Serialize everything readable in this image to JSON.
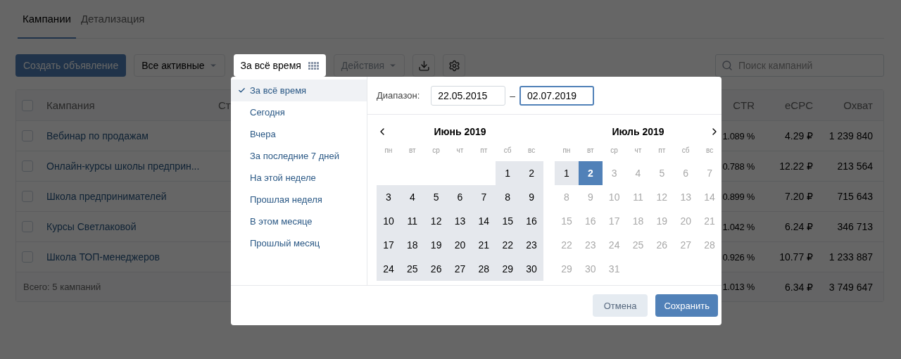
{
  "tabs": [
    {
      "label": "Кампании",
      "selected": true
    },
    {
      "label": "Детализация",
      "selected": false
    }
  ],
  "toolbar": {
    "create_button": "Создать объявление",
    "filter": {
      "label": "Все активные"
    },
    "period": {
      "label": "За всё время",
      "open": true
    },
    "actions": {
      "label": "Действия",
      "disabled": true
    }
  },
  "search": {
    "placeholder": "Поиск кампаний"
  },
  "table": {
    "select_all": {
      "checked": false
    },
    "columns": [
      "Кампания",
      "Ст",
      "CTR",
      "eCPC",
      "Охват"
    ],
    "rows": [
      {
        "checked": false,
        "name": "Вебинар по продажам",
        "ctr": "1.089 %",
        "ecpc": "4.29 ₽",
        "reach": "1 239 840"
      },
      {
        "checked": false,
        "name": "Онлайн-курсы школы предприн...",
        "ctr": "0.788 %",
        "ecpc": "12.22 ₽",
        "reach": "213 564"
      },
      {
        "checked": false,
        "name": "Школа предпринимателей",
        "ctr": "0.899 %",
        "ecpc": "7.20 ₽",
        "reach": "715 643"
      },
      {
        "checked": false,
        "name": "Курсы Светлаковой",
        "ctr": "1.042 %",
        "ecpc": "6.24 ₽",
        "reach": "346 713"
      },
      {
        "checked": false,
        "name": "Школа ТОП-менеджеров",
        "ctr": "0.926 %",
        "ecpc": "10.77 ₽",
        "reach": "1 233 887"
      }
    ],
    "footer": {
      "label": "Всего: 5 кампаний",
      "ctr": "1.013 %",
      "ecpc": "6.34 ₽",
      "reach": "3 749 647"
    }
  },
  "period_popup": {
    "presets": [
      {
        "label": "За всё время",
        "selected": true
      },
      {
        "label": "Сегодня",
        "selected": false
      },
      {
        "label": "Вчера",
        "selected": false
      },
      {
        "label": "За последние 7 дней",
        "selected": false
      },
      {
        "label": "На этой неделе",
        "selected": false
      },
      {
        "label": "Прошлая неделя",
        "selected": false
      },
      {
        "label": "В этом месяце",
        "selected": false
      },
      {
        "label": "Прошлый месяц",
        "selected": false
      }
    ],
    "range_label": "Диапазон:",
    "from": {
      "value": "22.05.2015",
      "focused": false
    },
    "separator": "–",
    "to": {
      "value": "02.07.2019",
      "focused": true
    },
    "months": [
      {
        "title": "Июнь 2019",
        "weekdays": [
          "пн",
          "вт",
          "ср",
          "чт",
          "пт",
          "сб",
          "вс"
        ],
        "weeks": [
          [
            {
              "kind": "blank"
            },
            {
              "kind": "blank"
            },
            {
              "kind": "blank"
            },
            {
              "kind": "blank"
            },
            {
              "kind": "blank"
            },
            {
              "kind": "day",
              "label": "1",
              "in_range": true,
              "selected": false,
              "disabled": false
            },
            {
              "kind": "day",
              "label": "2",
              "in_range": true,
              "selected": false,
              "disabled": false
            }
          ],
          [
            {
              "kind": "day",
              "label": "3",
              "in_range": true,
              "selected": false,
              "disabled": false
            },
            {
              "kind": "day",
              "label": "4",
              "in_range": true,
              "selected": false,
              "disabled": false
            },
            {
              "kind": "day",
              "label": "5",
              "in_range": true,
              "selected": false,
              "disabled": false
            },
            {
              "kind": "day",
              "label": "6",
              "in_range": true,
              "selected": false,
              "disabled": false
            },
            {
              "kind": "day",
              "label": "7",
              "in_range": true,
              "selected": false,
              "disabled": false
            },
            {
              "kind": "day",
              "label": "8",
              "in_range": true,
              "selected": false,
              "disabled": false
            },
            {
              "kind": "day",
              "label": "9",
              "in_range": true,
              "selected": false,
              "disabled": false
            }
          ],
          [
            {
              "kind": "day",
              "label": "10",
              "in_range": true,
              "selected": false,
              "disabled": false
            },
            {
              "kind": "day",
              "label": "11",
              "in_range": true,
              "selected": false,
              "disabled": false
            },
            {
              "kind": "day",
              "label": "12",
              "in_range": true,
              "selected": false,
              "disabled": false
            },
            {
              "kind": "day",
              "label": "13",
              "in_range": true,
              "selected": false,
              "disabled": false
            },
            {
              "kind": "day",
              "label": "14",
              "in_range": true,
              "selected": false,
              "disabled": false
            },
            {
              "kind": "day",
              "label": "15",
              "in_range": true,
              "selected": false,
              "disabled": false
            },
            {
              "kind": "day",
              "label": "16",
              "in_range": true,
              "selected": false,
              "disabled": false
            }
          ],
          [
            {
              "kind": "day",
              "label": "17",
              "in_range": true,
              "selected": false,
              "disabled": false
            },
            {
              "kind": "day",
              "label": "18",
              "in_range": true,
              "selected": false,
              "disabled": false
            },
            {
              "kind": "day",
              "label": "19",
              "in_range": true,
              "selected": false,
              "disabled": false
            },
            {
              "kind": "day",
              "label": "20",
              "in_range": true,
              "selected": false,
              "disabled": false
            },
            {
              "kind": "day",
              "label": "21",
              "in_range": true,
              "selected": false,
              "disabled": false
            },
            {
              "kind": "day",
              "label": "22",
              "in_range": true,
              "selected": false,
              "disabled": false
            },
            {
              "kind": "day",
              "label": "23",
              "in_range": true,
              "selected": false,
              "disabled": false
            }
          ],
          [
            {
              "kind": "day",
              "label": "24",
              "in_range": true,
              "selected": false,
              "disabled": false
            },
            {
              "kind": "day",
              "label": "25",
              "in_range": true,
              "selected": false,
              "disabled": false
            },
            {
              "kind": "day",
              "label": "26",
              "in_range": true,
              "selected": false,
              "disabled": false
            },
            {
              "kind": "day",
              "label": "27",
              "in_range": true,
              "selected": false,
              "disabled": false
            },
            {
              "kind": "day",
              "label": "28",
              "in_range": true,
              "selected": false,
              "disabled": false
            },
            {
              "kind": "day",
              "label": "29",
              "in_range": true,
              "selected": false,
              "disabled": false
            },
            {
              "kind": "day",
              "label": "30",
              "in_range": true,
              "selected": false,
              "disabled": false
            }
          ]
        ]
      },
      {
        "title": "Июль 2019",
        "weekdays": [
          "пн",
          "вт",
          "ср",
          "чт",
          "пт",
          "сб",
          "вс"
        ],
        "weeks": [
          [
            {
              "kind": "day",
              "label": "1",
              "in_range": true,
              "selected": false,
              "disabled": false
            },
            {
              "kind": "day",
              "label": "2",
              "in_range": true,
              "selected": true,
              "disabled": false
            },
            {
              "kind": "day",
              "label": "3",
              "in_range": false,
              "selected": false,
              "disabled": true
            },
            {
              "kind": "day",
              "label": "4",
              "in_range": false,
              "selected": false,
              "disabled": true
            },
            {
              "kind": "day",
              "label": "5",
              "in_range": false,
              "selected": false,
              "disabled": true
            },
            {
              "kind": "day",
              "label": "6",
              "in_range": false,
              "selected": false,
              "disabled": true
            },
            {
              "kind": "day",
              "label": "7",
              "in_range": false,
              "selected": false,
              "disabled": true
            }
          ],
          [
            {
              "kind": "day",
              "label": "8",
              "in_range": false,
              "selected": false,
              "disabled": true
            },
            {
              "kind": "day",
              "label": "9",
              "in_range": false,
              "selected": false,
              "disabled": true
            },
            {
              "kind": "day",
              "label": "10",
              "in_range": false,
              "selected": false,
              "disabled": true
            },
            {
              "kind": "day",
              "label": "11",
              "in_range": false,
              "selected": false,
              "disabled": true
            },
            {
              "kind": "day",
              "label": "12",
              "in_range": false,
              "selected": false,
              "disabled": true
            },
            {
              "kind": "day",
              "label": "13",
              "in_range": false,
              "selected": false,
              "disabled": true
            },
            {
              "kind": "day",
              "label": "14",
              "in_range": false,
              "selected": false,
              "disabled": true
            }
          ],
          [
            {
              "kind": "day",
              "label": "15",
              "in_range": false,
              "selected": false,
              "disabled": true
            },
            {
              "kind": "day",
              "label": "16",
              "in_range": false,
              "selected": false,
              "disabled": true
            },
            {
              "kind": "day",
              "label": "17",
              "in_range": false,
              "selected": false,
              "disabled": true
            },
            {
              "kind": "day",
              "label": "18",
              "in_range": false,
              "selected": false,
              "disabled": true
            },
            {
              "kind": "day",
              "label": "19",
              "in_range": false,
              "selected": false,
              "disabled": true
            },
            {
              "kind": "day",
              "label": "20",
              "in_range": false,
              "selected": false,
              "disabled": true
            },
            {
              "kind": "day",
              "label": "21",
              "in_range": false,
              "selected": false,
              "disabled": true
            }
          ],
          [
            {
              "kind": "day",
              "label": "22",
              "in_range": false,
              "selected": false,
              "disabled": true
            },
            {
              "kind": "day",
              "label": "23",
              "in_range": false,
              "selected": false,
              "disabled": true
            },
            {
              "kind": "day",
              "label": "24",
              "in_range": false,
              "selected": false,
              "disabled": true
            },
            {
              "kind": "day",
              "label": "25",
              "in_range": false,
              "selected": false,
              "disabled": true
            },
            {
              "kind": "day",
              "label": "26",
              "in_range": false,
              "selected": false,
              "disabled": true
            },
            {
              "kind": "day",
              "label": "27",
              "in_range": false,
              "selected": false,
              "disabled": true
            },
            {
              "kind": "day",
              "label": "28",
              "in_range": false,
              "selected": false,
              "disabled": true
            }
          ],
          [
            {
              "kind": "day",
              "label": "29",
              "in_range": false,
              "selected": false,
              "disabled": true
            },
            {
              "kind": "day",
              "label": "30",
              "in_range": false,
              "selected": false,
              "disabled": true
            },
            {
              "kind": "day",
              "label": "31",
              "in_range": false,
              "selected": false,
              "disabled": true
            }
          ]
        ]
      }
    ],
    "cancel": "Отмена",
    "save": "Сохранить"
  }
}
